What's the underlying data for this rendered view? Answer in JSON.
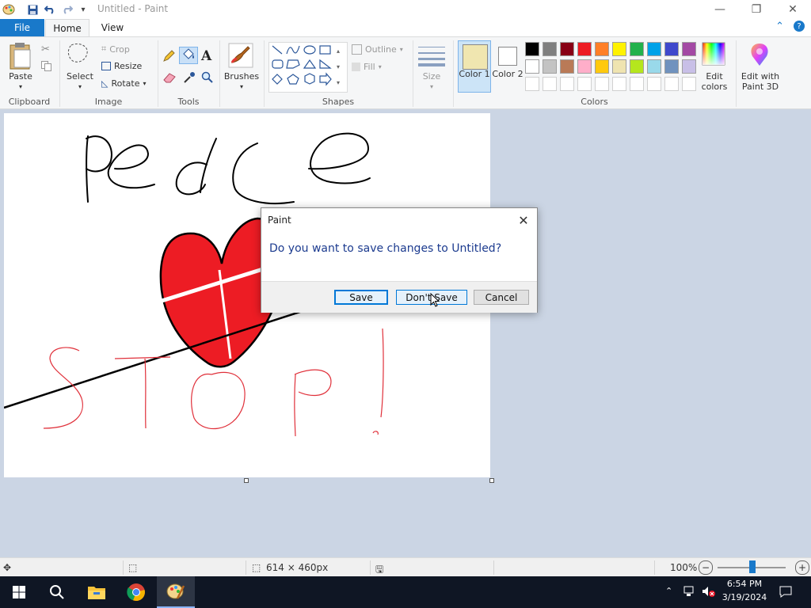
{
  "window": {
    "title": "Untitled - Paint"
  },
  "tabs": {
    "file": "File",
    "home": "Home",
    "view": "View"
  },
  "ribbon": {
    "clipboard": {
      "label": "Clipboard",
      "paste": "Paste"
    },
    "image": {
      "label": "Image",
      "select": "Select",
      "crop": "Crop",
      "resize": "Resize",
      "rotate": "Rotate"
    },
    "tools": {
      "label": "Tools"
    },
    "brushes": {
      "label": "Brushes"
    },
    "shapes": {
      "label": "Shapes",
      "outline": "Outline",
      "fill": "Fill"
    },
    "size": {
      "label": "Size"
    },
    "color1": {
      "label": "Color 1",
      "value": "#f0e6b0"
    },
    "color2": {
      "label": "Color 2",
      "value": "#ffffff"
    },
    "colors": {
      "label": "Colors",
      "edit": "Edit colors",
      "row1": [
        "#000000",
        "#7f7f7f",
        "#880015",
        "#ed1c24",
        "#ff7f27",
        "#fff200",
        "#22b14c",
        "#00a2e8",
        "#3f48cc",
        "#a349a4"
      ],
      "row2": [
        "#ffffff",
        "#c3c3c3",
        "#b97a57",
        "#ffaec9",
        "#ffc90e",
        "#efe4b0",
        "#b5e61d",
        "#99d9ea",
        "#7092be",
        "#c8bfe7"
      ]
    },
    "paint3d": {
      "label": "Edit with Paint 3D"
    }
  },
  "status": {
    "dimensions": "614 × 460px",
    "zoom": "100%"
  },
  "dialog": {
    "title": "Paint",
    "message": "Do you want to save changes to Untitled?",
    "save": "Save",
    "dont_save": "Don't Save",
    "cancel": "Cancel"
  },
  "taskbar": {
    "time": "6:54 PM",
    "date": "3/19/2024"
  }
}
